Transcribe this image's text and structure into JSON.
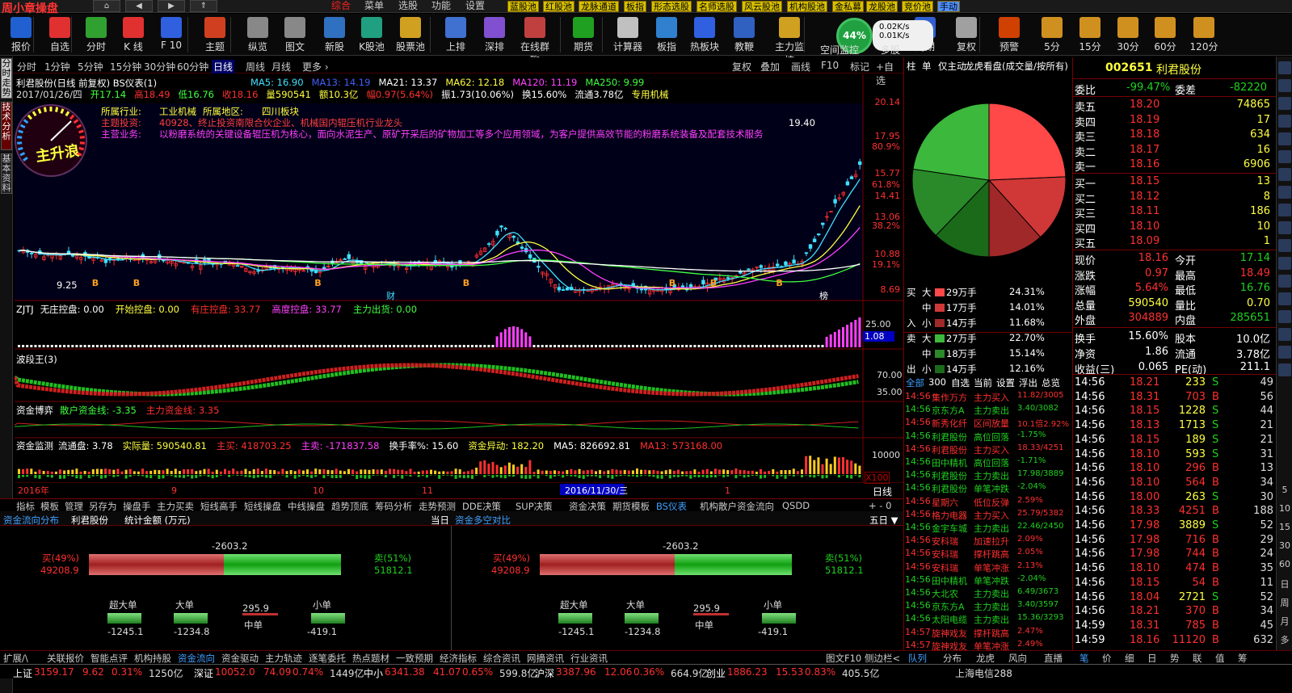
{
  "app": {
    "title": "周小章操盘"
  },
  "titlebar": {
    "menus": [
      "综合",
      "菜单",
      "选股",
      "功能",
      "设置"
    ],
    "active_menu": "综合",
    "pools": [
      "蓝股池",
      "红股池",
      "龙脉通道",
      "板指",
      "形态选股",
      "名师选股",
      "风云股池",
      "机构股池",
      "金私募",
      "龙股池",
      "竞价池",
      "手动"
    ]
  },
  "toolbar": {
    "tools": [
      "报价",
      "自选",
      "分时",
      "K 线",
      "F 10",
      "主题",
      "纵览",
      "图文",
      "新股",
      "K股池",
      "股票池",
      "上排",
      "深排",
      "在线群聊",
      "期货",
      "计算器",
      "板指",
      "热板块",
      "教鞭",
      "主力监控",
      "空间监控",
      "多股",
      "周期",
      "复权",
      "预警",
      "5分",
      "15分",
      "30分",
      "60分",
      "120分"
    ],
    "net": {
      "percent": "44%",
      "up": "0.02K/s",
      "down": "0.01K/s"
    }
  },
  "leftstrip": [
    "分时走势",
    "技术分析",
    "基本资料"
  ],
  "periods": [
    "分时",
    "1分钟",
    "5分钟",
    "15分钟",
    "30分钟",
    "60分钟",
    "日线",
    "周线",
    "月线",
    "更多"
  ],
  "period_active": "日线",
  "chart_tools": [
    "复权",
    "叠加",
    "画线",
    "F10",
    "标记",
    "+自选"
  ],
  "chart": {
    "title": "利君股份(日线 前复权) BS仪表(1)",
    "ma": [
      {
        "t": "MA5: 16.90",
        "c": "#40e0ff"
      },
      {
        "t": "MA13: 14.19",
        "c": "#4060ff"
      },
      {
        "t": "MA21: 13.37",
        "c": "#ffffff"
      },
      {
        "t": "MA62: 12.18",
        "c": "#ffff40"
      },
      {
        "t": "MA120: 11.19",
        "c": "#ff40ff"
      },
      {
        "t": "MA250: 9.99",
        "c": "#40ff40"
      }
    ],
    "info_line": [
      {
        "t": "2017/01/26/四",
        "c": "#dddddd"
      },
      {
        "t": "开17.14",
        "c": "#40ff40"
      },
      {
        "t": "高18.49",
        "c": "#ff3030"
      },
      {
        "t": "低16.76",
        "c": "#40ff40"
      },
      {
        "t": "收18.16",
        "c": "#ff3030"
      },
      {
        "t": "量590541",
        "c": "#ffff40"
      },
      {
        "t": "额10.3亿",
        "c": "#ffff40"
      },
      {
        "t": "幅0.97(5.64%)",
        "c": "#ff3030"
      },
      {
        "t": "振1.73(10.06%)",
        "c": "#ffffff"
      },
      {
        "t": "换15.60%",
        "c": "#ffffff"
      },
      {
        "t": "流通3.78亿",
        "c": "#ffffff"
      },
      {
        "t": "专用机械",
        "c": "#ffff40"
      }
    ],
    "industry": "所属行业:",
    "industry_v": "工业机械",
    "region": "所属地区:",
    "region_v": "四川板块",
    "theme": "主题投资:",
    "theme_v": "40928、终止投资南限合伙企业、机械国内辊压机行业龙头",
    "business": "主营业务:",
    "business_v": "以粉磨系统的关键设备辊压机为核心，面向水泥生产、原矿开采后的矿物加工等多个应用领域，为客户提供高效节能的粉磨系统装备及配套技术服务",
    "gauge_label": "主升浪",
    "peak": "19.40",
    "low": "9.25",
    "yaxis": [
      "20.14",
      "17.95",
      "80.9%",
      "15.77",
      "61.8%",
      "14.41",
      "13.06",
      "38.2%",
      "10.88",
      "19.1%",
      "8.69"
    ],
    "marks": [
      "财",
      "榜"
    ]
  },
  "zjtj": {
    "name": "ZJTJ",
    "items": [
      {
        "t": "无庄控盘: 0.00",
        "c": "#ffffff"
      },
      {
        "t": "开始控盘: 0.00",
        "c": "#ffff40"
      },
      {
        "t": "有庄控盘: 33.77",
        "c": "#ff3030"
      },
      {
        "t": "高度控盘: 33.77",
        "c": "#ff40ff"
      },
      {
        "t": "主力出货: 0.00",
        "c": "#40ff40"
      }
    ],
    "y": "25.00",
    "cur": "1.08"
  },
  "bdw": {
    "name": "波段王(3)",
    "y1": "70.00",
    "y2": "35.00"
  },
  "zjby": {
    "name": "资金博弈",
    "items": [
      {
        "t": "散户资金线: -3.35",
        "c": "#40ff40"
      },
      {
        "t": "主力资金线: 3.35",
        "c": "#ff3030"
      }
    ]
  },
  "zjjc": {
    "name": "资金监测",
    "items": [
      {
        "t": "流通盘: 3.78",
        "c": "#ffffff"
      },
      {
        "t": "实际量: 590540.81",
        "c": "#ffff40"
      },
      {
        "t": "主买: 418703.25",
        "c": "#ff3030"
      },
      {
        "t": "主卖: -171837.58",
        "c": "#ff40ff"
      },
      {
        "t": "换手率%: 15.60",
        "c": "#ffffff"
      },
      {
        "t": "资金异动: 182.20",
        "c": "#ffff40"
      },
      {
        "t": "MA5: 826692.81",
        "c": "#ffffff"
      },
      {
        "t": "MA13: 573168.00",
        "c": "#ff3030"
      }
    ],
    "y": "10000",
    "x100": "X100"
  },
  "xaxis": {
    "labels": [
      "2016年",
      "9",
      "10",
      "11",
      "2016/11/30/三",
      "1"
    ],
    "period": "日线"
  },
  "indicator_tabs": [
    "指标",
    "模板",
    "管理",
    "另存为",
    "操盘手",
    "主力买卖",
    "短线高手",
    "短线操盘",
    "中线操盘",
    "趋势顶底",
    "筹码分析",
    "走势预测",
    "DDE决策",
    "SUP决策",
    "资金决策",
    "期货模板",
    "BS仪表",
    "机构散户资金流向",
    "QSDD"
  ],
  "indicator_active": "BS仪表",
  "bottom": {
    "left_title": "资金流向分布",
    "stock": "利君股份",
    "stat": "统计金额 (万元)",
    "period": "当日",
    "right_title": "资金多空对比",
    "right_period": "五日",
    "net": "-2603.2",
    "buy_pct": "买(49%)",
    "buy_v": "49208.9",
    "sell_pct": "卖(51%)",
    "sell_v": "51812.1",
    "buy_fraction": 0.49,
    "cats": [
      {
        "n": "超大单",
        "v": "-1245.1"
      },
      {
        "n": "大单",
        "v": "-1234.8"
      },
      {
        "n": "中单",
        "v": "295.9"
      },
      {
        "n": "小单",
        "v": "-419.1"
      }
    ]
  },
  "bottom_tabs": [
    "扩展/\\",
    "关联报价",
    "智能点评",
    "机构持股",
    "资金流向",
    "资金驱动",
    "主力轨迹",
    "逐笔委托",
    "热点题材",
    "一致预期",
    "经济指标",
    "综合资讯",
    "网摘资讯",
    "行业资讯"
  ],
  "bottom_tabs_active": "资金流向",
  "bottom_right_tabs": [
    "图文F10",
    "侧边栏<",
    "队列",
    "分布",
    "龙虎",
    "风向",
    "直播"
  ],
  "mid": {
    "header": [
      "柱",
      "单",
      "仅主动",
      "龙虎看盘(成交量/按所有)"
    ],
    "pie": [
      {
        "c": "#ff4848",
        "pct": 24.31
      },
      {
        "c": "#d03838",
        "pct": 14.01
      },
      {
        "c": "#a02828",
        "pct": 11.68
      },
      {
        "c": "#1a6a1a",
        "pct": 12.16
      },
      {
        "c": "#2a8a2a",
        "pct": 15.14
      },
      {
        "c": "#3cb83c",
        "pct": 22.7
      }
    ],
    "buy_sell": [
      {
        "side": "买",
        "size": "大",
        "v": "29万手",
        "p": "24.31%",
        "c": "#ff4848"
      },
      {
        "side": "",
        "size": "中",
        "v": "17万手",
        "p": "14.01%",
        "c": "#d03838"
      },
      {
        "side": "入",
        "size": "小",
        "v": "14万手",
        "p": "11.68%",
        "c": "#a02828"
      },
      {
        "side": "卖",
        "size": "大",
        "v": "27万手",
        "p": "22.70%",
        "c": "#3cb83c"
      },
      {
        "side": "",
        "size": "中",
        "v": "18万手",
        "p": "15.14%",
        "c": "#2a8a2a"
      },
      {
        "side": "出",
        "size": "小",
        "v": "14万手",
        "p": "12.16%",
        "c": "#1a6a1a"
      }
    ],
    "list_tabs": [
      "全部",
      "300",
      "自选",
      "当前",
      "设置",
      "浮出",
      "总览"
    ],
    "news": [
      {
        "t": "14:56",
        "n": "集作万方",
        "a": "主力买入",
        "v": "11.82/3005",
        "c": "#ff3030"
      },
      {
        "t": "14:56",
        "n": "京东方A",
        "a": "主力卖出",
        "v": "3.40/3082",
        "c": "#20d020"
      },
      {
        "t": "14:56",
        "n": "新秀化纤",
        "a": "区间放量",
        "v": "10.1倍2.92%",
        "c": "#ff3030"
      },
      {
        "t": "14:56",
        "n": "利君股份",
        "a": "高位回落",
        "v": "-1.75%",
        "c": "#20d020"
      },
      {
        "t": "14:56",
        "n": "利君股份",
        "a": "主力买入",
        "v": "18.33/4251",
        "c": "#ff3030"
      },
      {
        "t": "14:56",
        "n": "田中精机",
        "a": "高位回落",
        "v": "-1.71%",
        "c": "#20d020"
      },
      {
        "t": "14:56",
        "n": "利君股份",
        "a": "主力卖出",
        "v": "17.98/3889",
        "c": "#20d020"
      },
      {
        "t": "14:56",
        "n": "利君股份",
        "a": "单笔冲跌",
        "v": "-2.04%",
        "c": "#20d020"
      },
      {
        "t": "14:56",
        "n": "星期六",
        "a": "低位反弹",
        "v": "2.59%",
        "c": "#ff3030"
      },
      {
        "t": "14:56",
        "n": "格力电器",
        "a": "主力买入",
        "v": "25.79/5382",
        "c": "#ff3030"
      },
      {
        "t": "14:56",
        "n": "金宇车城",
        "a": "主力卖出",
        "v": "22.46/2450",
        "c": "#20d020"
      },
      {
        "t": "14:56",
        "n": "安科瑞",
        "a": "加速拉升",
        "v": "2.09%",
        "c": "#ff3030"
      },
      {
        "t": "14:56",
        "n": "安科瑞",
        "a": "撑杆跳高",
        "v": "2.05%",
        "c": "#ff3030"
      },
      {
        "t": "14:56",
        "n": "安科瑞",
        "a": "单笔冲涨",
        "v": "2.13%",
        "c": "#ff3030"
      },
      {
        "t": "14:56",
        "n": "田中精机",
        "a": "单笔冲跌",
        "v": "-2.04%",
        "c": "#20d020"
      },
      {
        "t": "14:56",
        "n": "大北农",
        "a": "主力卖出",
        "v": "6.49/3673",
        "c": "#20d020"
      },
      {
        "t": "14:56",
        "n": "京东方A",
        "a": "主力卖出",
        "v": "3.40/3597",
        "c": "#20d020"
      },
      {
        "t": "14:56",
        "n": "太阳电缆",
        "a": "主力卖出",
        "v": "15.36/3293",
        "c": "#20d020"
      },
      {
        "t": "14:57",
        "n": "旋神戏友",
        "a": "撑杆跳高",
        "v": "2.47%",
        "c": "#ff3030"
      },
      {
        "t": "14:57",
        "n": "旋神戏友",
        "a": "单笔冲涨",
        "v": "2.49%",
        "c": "#ff3030"
      }
    ]
  },
  "quote": {
    "code": "002651",
    "name": "利君股份",
    "wb": "-99.47%",
    "wc": "-82220",
    "sells": [
      {
        "l": "卖五",
        "p": "18.20",
        "v": "74865"
      },
      {
        "l": "卖四",
        "p": "18.19",
        "v": "17"
      },
      {
        "l": "卖三",
        "p": "18.18",
        "v": "634"
      },
      {
        "l": "卖二",
        "p": "18.17",
        "v": "16"
      },
      {
        "l": "卖一",
        "p": "18.16",
        "v": "6906"
      }
    ],
    "buys": [
      {
        "l": "买一",
        "p": "18.15",
        "v": "13"
      },
      {
        "l": "买二",
        "p": "18.12",
        "v": "8"
      },
      {
        "l": "买三",
        "p": "18.11",
        "v": "186"
      },
      {
        "l": "买四",
        "p": "18.10",
        "v": "10"
      },
      {
        "l": "买五",
        "p": "18.09",
        "v": "1"
      }
    ],
    "stats": [
      [
        {
          "l": "现价",
          "v": "18.16",
          "c": "#ff3030"
        },
        {
          "l": "今开",
          "v": "17.14",
          "c": "#20d020"
        }
      ],
      [
        {
          "l": "涨跌",
          "v": "0.97",
          "c": "#ff3030"
        },
        {
          "l": "最高",
          "v": "18.49",
          "c": "#ff3030"
        }
      ],
      [
        {
          "l": "涨幅",
          "v": "5.64%",
          "c": "#ff3030"
        },
        {
          "l": "最低",
          "v": "16.76",
          "c": "#20d020"
        }
      ],
      [
        {
          "l": "总量",
          "v": "590540",
          "c": "#ffff40"
        },
        {
          "l": "量比",
          "v": "0.70",
          "c": "#ffff40"
        }
      ],
      [
        {
          "l": "外盘",
          "v": "304889",
          "c": "#ff3030"
        },
        {
          "l": "内盘",
          "v": "285651",
          "c": "#20d020"
        }
      ],
      [
        {
          "l": "换手",
          "v": "15.60%",
          "c": "#ffffff"
        },
        {
          "l": "股本",
          "v": "10.0亿",
          "c": "#ffffff"
        }
      ],
      [
        {
          "l": "净资",
          "v": "1.86",
          "c": "#ffffff"
        },
        {
          "l": "流通",
          "v": "3.78亿",
          "c": "#ffffff"
        }
      ],
      [
        {
          "l": "收益(三)",
          "v": "0.065",
          "c": "#ffffff"
        },
        {
          "l": "PE(动)",
          "v": "211.1",
          "c": "#ffffff"
        }
      ]
    ],
    "ticks": [
      {
        "t": "14:56",
        "p": "18.21",
        "v": "233",
        "s": "S",
        "n": "49"
      },
      {
        "t": "14:56",
        "p": "18.31",
        "v": "703",
        "s": "B",
        "n": "56"
      },
      {
        "t": "14:56",
        "p": "18.15",
        "v": "1228",
        "s": "S",
        "n": "44"
      },
      {
        "t": "14:56",
        "p": "18.13",
        "v": "1713",
        "s": "S",
        "n": "21"
      },
      {
        "t": "14:56",
        "p": "18.15",
        "v": "189",
        "s": "S",
        "n": "21"
      },
      {
        "t": "14:56",
        "p": "18.10",
        "v": "593",
        "s": "S",
        "n": "31"
      },
      {
        "t": "14:56",
        "p": "18.10",
        "v": "296",
        "s": "B",
        "n": "13"
      },
      {
        "t": "14:56",
        "p": "18.10",
        "v": "564",
        "s": "B",
        "n": "34"
      },
      {
        "t": "14:56",
        "p": "18.00",
        "v": "263",
        "s": "S",
        "n": "30"
      },
      {
        "t": "14:56",
        "p": "18.33",
        "v": "4251",
        "s": "B",
        "n": "188"
      },
      {
        "t": "14:56",
        "p": "17.98",
        "v": "3889",
        "s": "S",
        "n": "52"
      },
      {
        "t": "14:56",
        "p": "17.98",
        "v": "716",
        "s": "B",
        "n": "29"
      },
      {
        "t": "14:56",
        "p": "17.98",
        "v": "744",
        "s": "B",
        "n": "24"
      },
      {
        "t": "14:56",
        "p": "18.10",
        "v": "474",
        "s": "B",
        "n": "35"
      },
      {
        "t": "14:56",
        "p": "18.15",
        "v": "54",
        "s": "B",
        "n": "11"
      },
      {
        "t": "14:56",
        "p": "18.04",
        "v": "2721",
        "s": "S",
        "n": "52"
      },
      {
        "t": "14:56",
        "p": "18.21",
        "v": "370",
        "s": "B",
        "n": "34"
      },
      {
        "t": "14:59",
        "p": "18.31",
        "v": "785",
        "s": "B",
        "n": "45"
      },
      {
        "t": "14:59",
        "p": "18.16",
        "v": "11120",
        "s": "B",
        "n": "632"
      }
    ],
    "bottom_tabs": [
      "笔",
      "价",
      "细",
      "日",
      "势",
      "联",
      "值",
      "筹"
    ]
  },
  "rightstrip": [
    "5",
    "10",
    "15",
    "30",
    "60",
    "日",
    "周",
    "月",
    "多",
    "年"
  ],
  "status": {
    "items": [
      {
        "n": "上证",
        "v": "3159.17",
        "d": "9.62",
        "p": "0.31%",
        "a": "1250亿"
      },
      {
        "n": "深证",
        "v": "10052.0",
        "d": "74.09",
        "p": "0.74%",
        "a": "1449亿"
      },
      {
        "n": "中小",
        "v": "6341.38",
        "d": "41.07",
        "p": "0.65%",
        "a": "599.8亿"
      },
      {
        "n": "沪深",
        "v": "3387.96",
        "d": "12.06",
        "p": "0.36%",
        "a": "664.9亿"
      },
      {
        "n": "创业",
        "v": "1886.23",
        "d": "15.53",
        "p": "0.83%",
        "a": "405.5亿"
      }
    ],
    "server": "上海电信288"
  }
}
